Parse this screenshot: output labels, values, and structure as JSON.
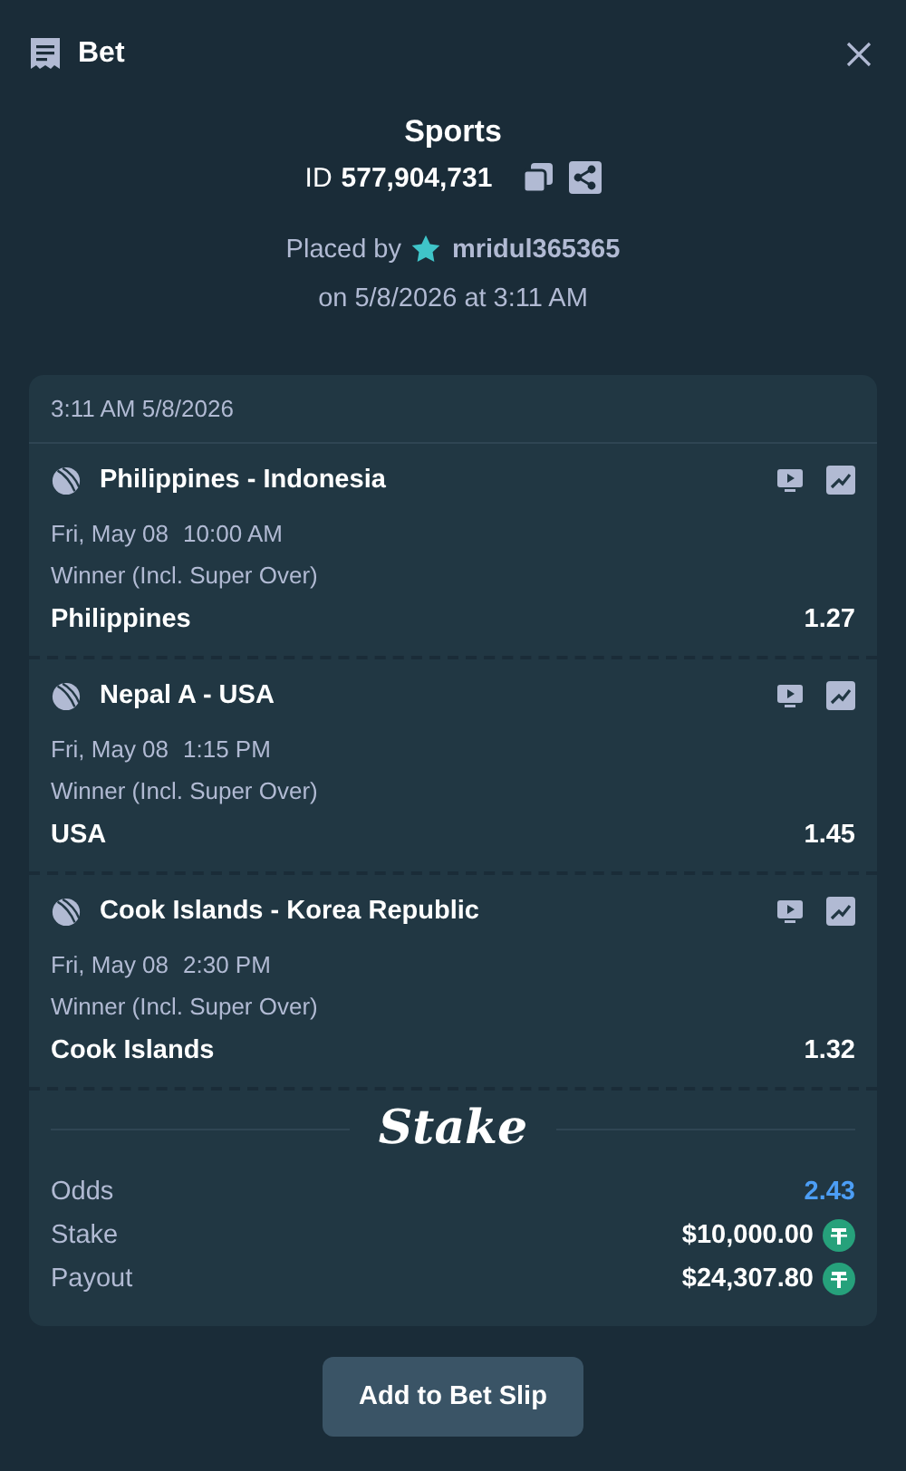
{
  "header": {
    "title": "Bet"
  },
  "summary": {
    "category": "Sports",
    "id_label": "ID",
    "id": "577,904,731",
    "placed_by_label": "Placed by",
    "user": "mridul365365",
    "placed_on": "on 5/8/2026 at 3:11 AM"
  },
  "card": {
    "timestamp": "3:11 AM 5/8/2026",
    "legs": [
      {
        "match": "Philippines - Indonesia",
        "date": "Fri, May 08",
        "time": "10:00 AM",
        "market": "Winner (Incl. Super Over)",
        "pick": "Philippines",
        "odds": "1.27"
      },
      {
        "match": "Nepal A - USA",
        "date": "Fri, May 08",
        "time": "1:15 PM",
        "market": "Winner (Incl. Super Over)",
        "pick": "USA",
        "odds": "1.45"
      },
      {
        "match": "Cook Islands - Korea Republic",
        "date": "Fri, May 08",
        "time": "2:30 PM",
        "market": "Winner (Incl. Super Over)",
        "pick": "Cook Islands",
        "odds": "1.32"
      }
    ],
    "logo": "Stake",
    "totals": [
      {
        "label": "Odds",
        "value": "2.43",
        "kind": "odds"
      },
      {
        "label": "Stake",
        "value": "$10,000.00",
        "kind": "money"
      },
      {
        "label": "Payout",
        "value": "$24,307.80",
        "kind": "money"
      }
    ]
  },
  "button": "Add to Bet Slip"
}
